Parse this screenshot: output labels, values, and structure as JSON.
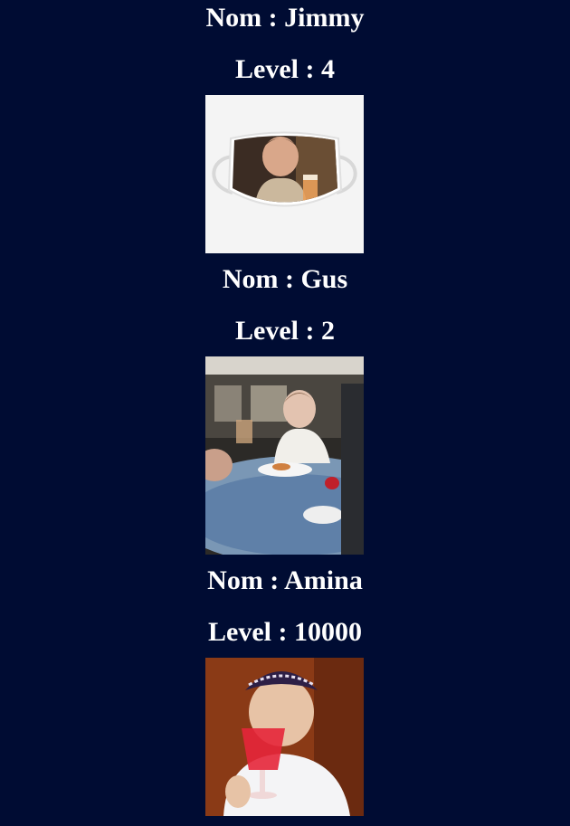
{
  "profiles": [
    {
      "name": "Nom : Jimmy",
      "level": "Level : 4"
    },
    {
      "name": "Nom : Gus",
      "level": "Level : 2"
    },
    {
      "name": "Nom : Amina",
      "level": "Level : 10000"
    }
  ]
}
